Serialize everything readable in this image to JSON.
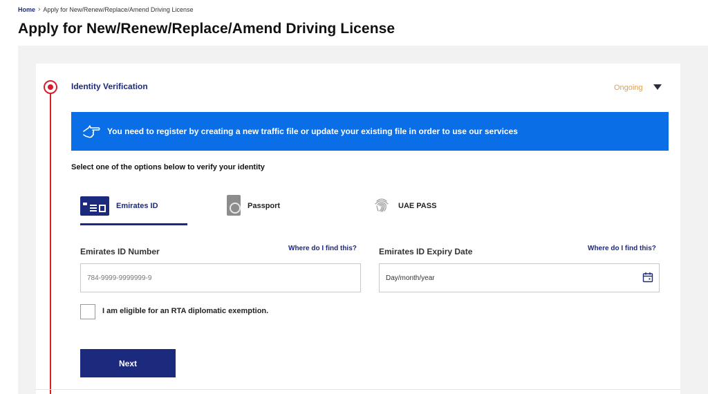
{
  "breadcrumb": {
    "home": "Home",
    "separator": "›",
    "current": "Apply for New/Renew/Replace/Amend Driving License"
  },
  "page_title": "Apply for New/Renew/Replace/Amend Driving License",
  "step": {
    "title": "Identity Verification",
    "status": "Ongoing",
    "status_color": "#e0a050",
    "accent_color": "#d81d2a"
  },
  "banner": {
    "icon": "pointing-hand-icon",
    "text": "You need to register by creating a new traffic file or update your existing file in order to use our services",
    "color": "#0a6ee6"
  },
  "instruction": "Select one of the options below to verify your identity",
  "tabs": [
    {
      "label": "Emirates ID",
      "icon": "emirates-id-card-icon",
      "active": true
    },
    {
      "label": "Passport",
      "icon": "passport-icon",
      "active": false
    },
    {
      "label": "UAE PASS",
      "icon": "fingerprint-icon",
      "active": false
    }
  ],
  "form": {
    "eid_number": {
      "label": "Emirates ID Number",
      "help": "Where do I find this?",
      "placeholder": "784-9999-9999999-9",
      "value": ""
    },
    "eid_expiry": {
      "label": "Emirates ID Expiry Date",
      "help": "Where do I find this?",
      "placeholder": "Day/month/year",
      "value": "",
      "icon": "calendar-icon"
    },
    "diplomatic": {
      "label": "I am eligible for an RTA diplomatic exemption.",
      "checked": false
    }
  },
  "next_button": "Next",
  "brand_color": "#1c2a7d"
}
